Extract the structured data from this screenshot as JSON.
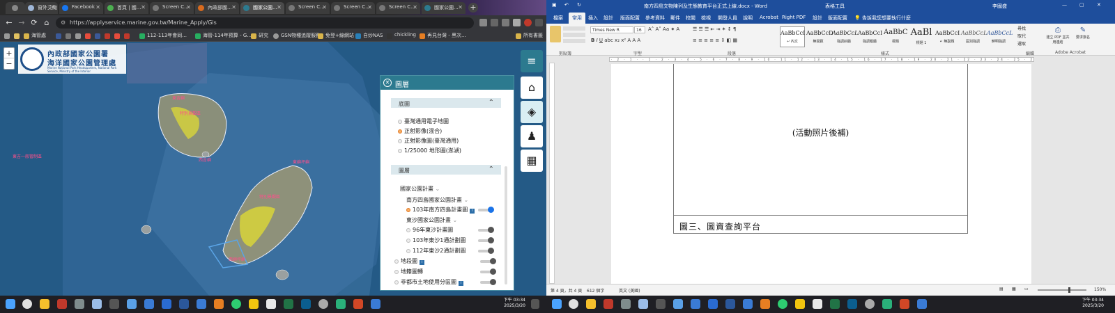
{
  "chrome": {
    "tabs": [
      {
        "label": "窗外艾颱 -"
      },
      {
        "label": "Facebook"
      },
      {
        "label": "首頁 | 國..."
      },
      {
        "label": "Screen C..."
      },
      {
        "label": "內政部國..."
      },
      {
        "label": "國家公園..."
      },
      {
        "label": "Screen C..."
      },
      {
        "label": "Screen C..."
      },
      {
        "label": "Screen C..."
      },
      {
        "label": "國家公園..."
      }
    ],
    "new_tab": "+",
    "url": "https://applyservice.marine.gov.tw/Marine_Apply/Gis",
    "bookmarks": [
      {
        "label": "海管處"
      },
      {
        "label": "112-113年會同..."
      },
      {
        "label": "海管-114年預算 - G..."
      },
      {
        "label": "研究"
      },
      {
        "label": "GSN物種追蹤服務"
      },
      {
        "label": "免登+線網站"
      },
      {
        "label": "自炒NAS"
      },
      {
        "label": "chickling"
      },
      {
        "label": "再見台灣 - 黑次..."
      }
    ],
    "all_bookmarks": "所有書籤",
    "colors": {
      "accent": "#2c7a8f",
      "map_sea": "#245a86"
    }
  },
  "map": {
    "zoom_in": "+",
    "zoom_out": "−",
    "logo": {
      "line1": "內政部國家公園署",
      "line2": "海洋國家公園管理處",
      "line3": "Marine National Park Headquarters, National Park Service, Ministry of the Interior"
    },
    "labels": [
      "東吉一般管制區",
      "東吉嶼",
      "特別景觀區",
      "西吉嶼",
      "東嶼坪嶼",
      "特別景觀區",
      "西嶼坪嶼"
    ]
  },
  "layer_panel": {
    "title": "圖層",
    "close": "✕",
    "basemap": {
      "header": "底圖",
      "options": [
        {
          "label": "臺灣通用電子地圖",
          "selected": false
        },
        {
          "label": "正射影像(混合)",
          "selected": true
        },
        {
          "label": "正射影像圖(臺灣通用)",
          "selected": false
        },
        {
          "label": "1/25000 地形圖(澎湖)",
          "selected": false
        }
      ]
    },
    "layers": {
      "header": "圖層",
      "group": "國家公園計畫",
      "items": [
        {
          "label": "南方四島國家公園計畫"
        },
        {
          "label": "103年南方四島計畫圖",
          "on": true
        },
        {
          "label": "東沙國家公園計畫"
        },
        {
          "label": "96年東沙計畫圖",
          "on": false
        },
        {
          "label": "103年東沙1通計劃圖",
          "on": false
        },
        {
          "label": "112年東沙2通計劃圖",
          "on": false
        },
        {
          "label": "地段圖",
          "on": false
        },
        {
          "label": "地籍圖轉",
          "on": false
        },
        {
          "label": "非都市土地使用分區圖",
          "on": false
        }
      ]
    }
  },
  "tools": {
    "menu": "≡",
    "home": "⌂",
    "layers": "◈",
    "person": "♟",
    "qr": "▦"
  },
  "taskbar_left": {
    "time": "下午 03:34",
    "date": "2025/3/20"
  },
  "word": {
    "title": "南方四島文物陳列及生態教育平台正式上線.docx - Word",
    "table_tools": "表格工具",
    "user": "李國盛",
    "tabs": [
      "檔案",
      "常用",
      "插入",
      "設計",
      "版面配置",
      "參考資料",
      "郵件",
      "校閱",
      "檢視",
      "開發人員",
      "說明",
      "Acrobat",
      "Right PDF",
      "設計",
      "版面配置"
    ],
    "tell_me": "告訴我您想要執行什麼",
    "font_name": "Times New R",
    "font_size": "16",
    "groups": [
      "剪貼簿",
      "字型",
      "段落",
      "樣式",
      "編輯",
      "Adobe Acrobat"
    ],
    "styles": [
      {
        "preview": "AaBbCcI",
        "name": "↵ 內文"
      },
      {
        "preview": "AaBbCcD",
        "name": "無間距"
      },
      {
        "preview": "AaBbCcL",
        "name": "強調斜體"
      },
      {
        "preview": "AaBbCcI",
        "name": "強調粗體"
      },
      {
        "preview": "AaBbC",
        "name": "標題"
      },
      {
        "preview": "AaBl",
        "name": "標題 1"
      },
      {
        "preview": "AaBbCcI",
        "name": "↵ 無副題"
      },
      {
        "preview": "AaBbCcL",
        "name": "區別強調"
      },
      {
        "preview": "AaBbCcL",
        "name": "鮮明強調"
      }
    ],
    "editing": [
      "尋找",
      "取代",
      "選取"
    ],
    "acrobat": [
      "建立 PDF 並共用連結",
      "要求簽名"
    ],
    "photo_placeholder": "(活動照片後補)",
    "caption": "圖三、圖資查詢平台",
    "status": {
      "page": "第 4 頁，共 4 頁",
      "words": "612 個字",
      "lang": "英文 (美國)",
      "zoom": "150%"
    },
    "clock": {
      "time": "下午 03:34",
      "date": "2025/3/20"
    }
  }
}
